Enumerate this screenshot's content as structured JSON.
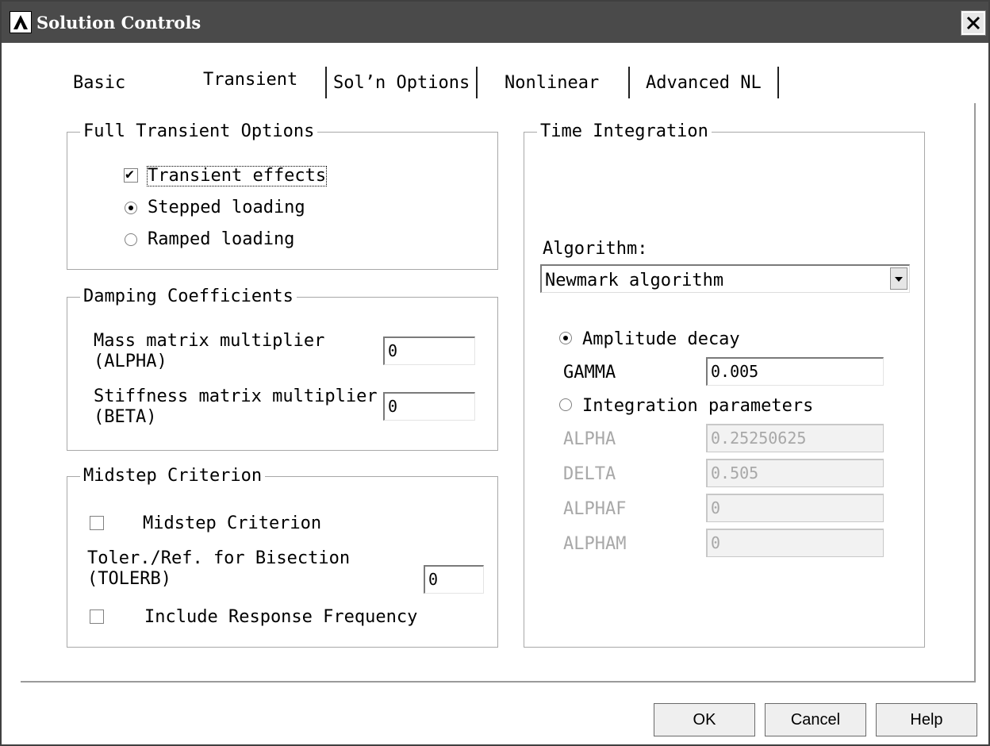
{
  "window": {
    "title": "Solution Controls"
  },
  "tabs": [
    {
      "label": "Basic"
    },
    {
      "label": "Transient"
    },
    {
      "label": "Sol’n Options"
    },
    {
      "label": "Nonlinear"
    },
    {
      "label": "Advanced NL"
    }
  ],
  "full_transient": {
    "title": "Full Transient Options",
    "transient_effects": {
      "label": "Transient effects",
      "checked": true
    },
    "stepped_loading": {
      "label": "Stepped loading",
      "selected": true
    },
    "ramped_loading": {
      "label": "Ramped loading",
      "selected": false
    }
  },
  "damping": {
    "title": "Damping Coefficients",
    "mass_label_1": "Mass matrix multiplier",
    "mass_label_2": "(ALPHA)",
    "mass_value": "0",
    "stiff_label_1": "Stiffness matrix multiplier",
    "stiff_label_2": "(BETA)",
    "stiff_value": "0"
  },
  "midstep": {
    "title": "Midstep Criterion",
    "criterion_label": "Midstep Criterion",
    "criterion_checked": false,
    "toler_label_1": "Toler./Ref. for Bisection",
    "toler_label_2": "(TOLERB)",
    "toler_value": "0",
    "response_label": "Include Response Frequency",
    "response_checked": false
  },
  "time_integration": {
    "title": "Time Integration",
    "algorithm_label": "Algorithm:",
    "algorithm_value": "Newmark algorithm",
    "amplitude_decay_label": "Amplitude decay",
    "amplitude_decay_selected": true,
    "gamma_label": "GAMMA",
    "gamma_value": "0.005",
    "integration_params_label": "Integration parameters",
    "integration_params_selected": false,
    "alpha_label": "ALPHA",
    "alpha_value": "0.25250625",
    "delta_label": "DELTA",
    "delta_value": "0.505",
    "alphaf_label": "ALPHAF",
    "alphaf_value": "0",
    "alpham_label": "ALPHAM",
    "alpham_value": "0"
  },
  "buttons": {
    "ok": "OK",
    "cancel": "Cancel",
    "help": "Help"
  },
  "icons": {
    "close": "close-icon",
    "app": "ansys-logo-icon"
  },
  "colors": {
    "titlebar": "#4a4a4a",
    "group_border": "#a8a8a8",
    "disabled_text": "#a8a8a8"
  }
}
